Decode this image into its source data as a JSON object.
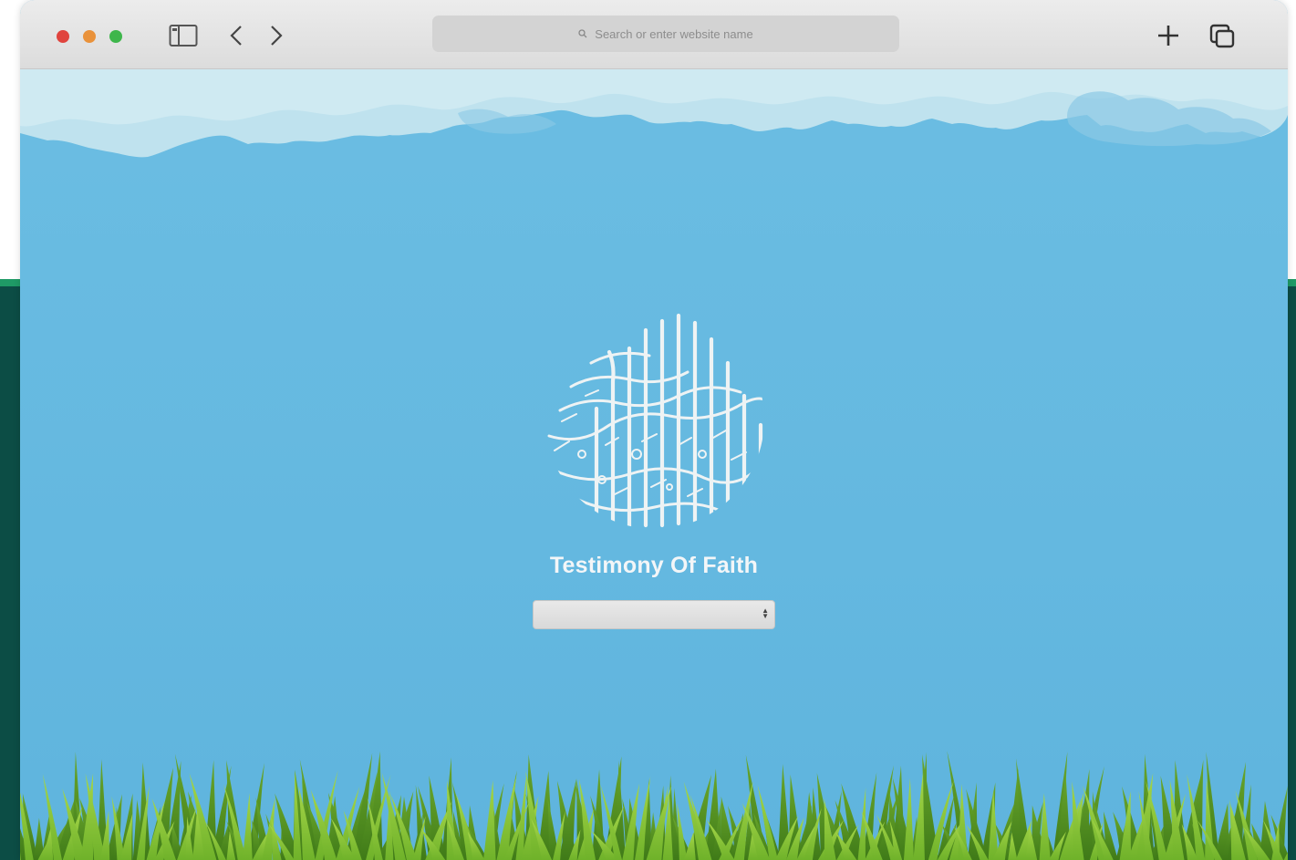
{
  "browser": {
    "address_placeholder": "Search or enter website name"
  },
  "page": {
    "heading": "Testimony Of Faith",
    "select": {
      "selected_value": ""
    }
  },
  "colors": {
    "sky": "#66b9e0",
    "backdrop": "#0c4d45",
    "backdrop_stripe": "#1f9a66",
    "grass_dark": "#4f8f1f",
    "grass_light": "#8cc63f"
  },
  "icons": {
    "toolbar": [
      "sidebar-icon",
      "back-icon",
      "forward-icon",
      "search-icon",
      "new-tab-icon",
      "tabs-overview-icon"
    ],
    "emblem": "shahada-calligraphy-emblem"
  }
}
